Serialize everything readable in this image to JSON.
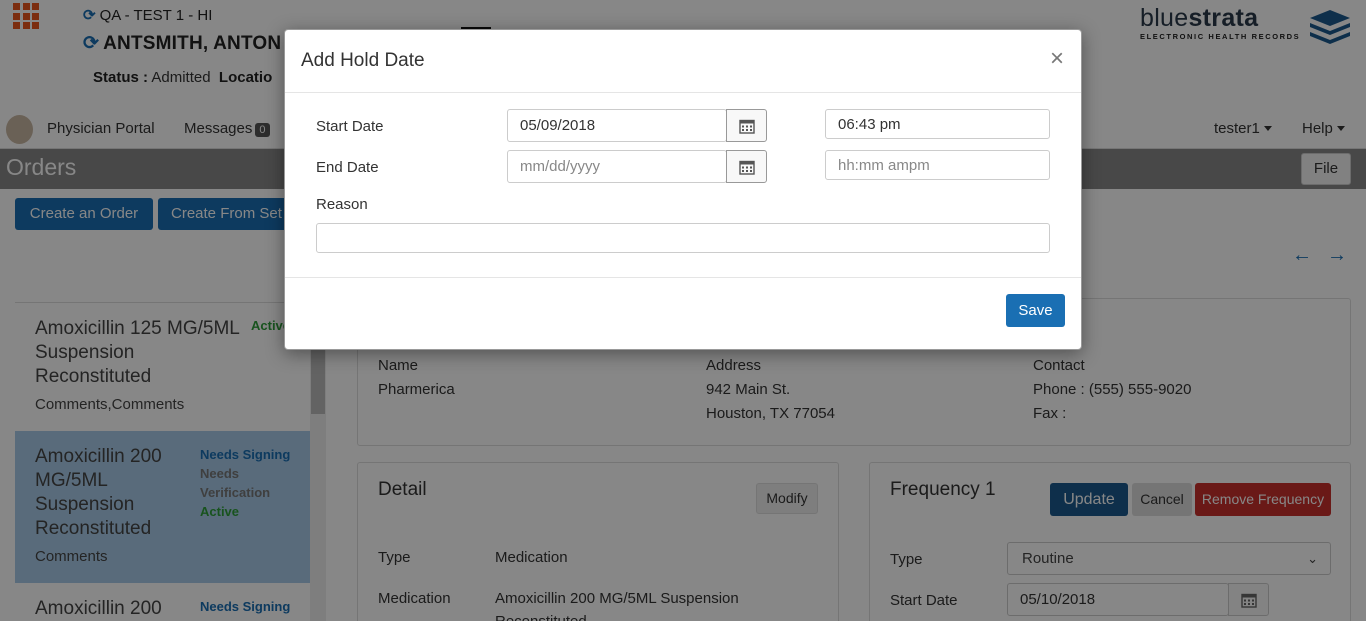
{
  "header": {
    "env": "QA - TEST 1 - HI",
    "patient": "ANTSMITH, ANTON",
    "status_label": "Status :",
    "status_value": "Admitted",
    "location_label": "Locatio",
    "logo_light": "blue",
    "logo_bold": "strata",
    "logo_tagline": "ELECTRONIC HEALTH RECORDS"
  },
  "nav": {
    "portal": "Physician Portal",
    "messages": "Messages",
    "message_count": "0",
    "user": "tester1",
    "help": "Help"
  },
  "orders": {
    "title": "Orders",
    "file": "File",
    "create_order": "Create an Order",
    "create_from_set": "Create From Set"
  },
  "order_list": [
    {
      "name": "Amoxicillin 125 MG/5ML Suspension Reconstituted",
      "comments": "Comments,Comments",
      "status": [
        "Active"
      ]
    },
    {
      "name": "Amoxicillin 200 MG/5ML Suspension Reconstituted",
      "comments": "Comments",
      "status": [
        "Needs Signing",
        "Needs Verification",
        "Active"
      ]
    },
    {
      "name": "Amoxicillin 200",
      "status": [
        "Needs Signing"
      ]
    }
  ],
  "pharmacy": {
    "name_label": "Name",
    "name_value": "Pharmerica",
    "address_label": "Address",
    "address_line1": "942 Main St.",
    "address_line2": "Houston, TX 77054",
    "contact_label": "Contact",
    "phone": "Phone : (555) 555-9020",
    "fax": "Fax :"
  },
  "detail": {
    "title": "Detail",
    "modify": "Modify",
    "type_label": "Type",
    "type_value": "Medication",
    "medication_label": "Medication",
    "medication_value": "Amoxicillin 200 MG/5ML Suspension",
    "medication_value2": "Reconstituted"
  },
  "frequency": {
    "title": "Frequency 1",
    "update": "Update",
    "cancel": "Cancel",
    "remove": "Remove Frequency",
    "type_label": "Type",
    "type_value": "Routine",
    "start_label": "Start Date",
    "start_value": "05/10/2018"
  },
  "modal": {
    "title": "Add Hold Date",
    "close": "×",
    "start_label": "Start Date",
    "start_date": "05/09/2018",
    "start_time": "06:43 pm",
    "end_label": "End Date",
    "end_date_placeholder": "mm/dd/yyyy",
    "end_time_placeholder": "hh:mm ampm",
    "reason_label": "Reason",
    "save": "Save"
  },
  "colors": {
    "primary": "#1a6fb3",
    "danger": "#c9302c",
    "dark_primary": "#1b5a8e",
    "grid_icon": "#e8561e",
    "selected_row": "#a9cbe8",
    "active": "#2e9e3a"
  }
}
